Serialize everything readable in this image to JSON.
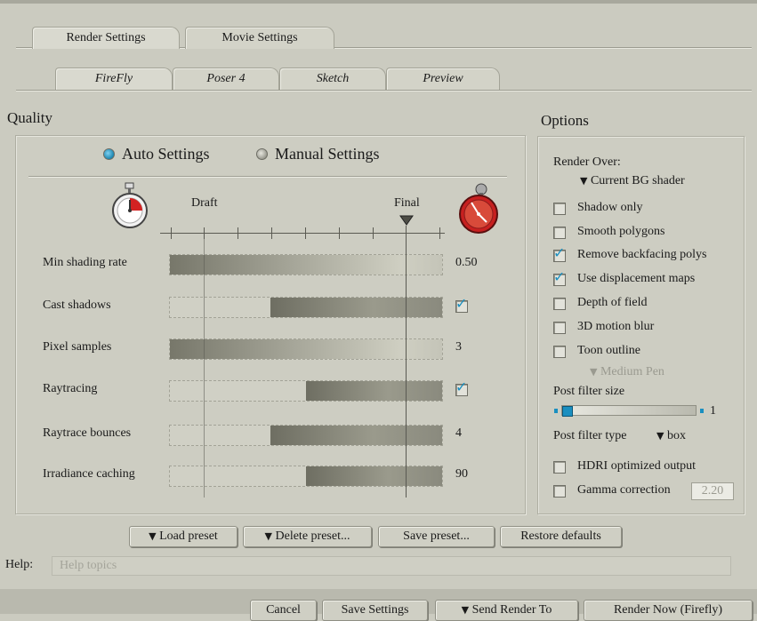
{
  "tabs_top": [
    "Render Settings",
    "Movie Settings"
  ],
  "tabs_sub": [
    "FireFly",
    "Poser 4",
    "Sketch",
    "Preview"
  ],
  "quality": {
    "title": "Quality",
    "auto_label": "Auto Settings",
    "manual_label": "Manual Settings",
    "draft_label": "Draft",
    "final_label": "Final",
    "rows": [
      {
        "label": "Min shading rate",
        "value": "0.50",
        "level": 1.0
      },
      {
        "label": "Cast shadows",
        "value": "",
        "level": 0.63
      },
      {
        "label": "Pixel samples",
        "value": "3",
        "level": 1.0
      },
      {
        "label": "Raytracing",
        "value": "",
        "level": 0.5
      },
      {
        "label": "Raytrace bounces",
        "value": "4",
        "level": 0.63
      },
      {
        "label": "Irradiance caching",
        "value": "90",
        "level": 0.5
      }
    ]
  },
  "options": {
    "title": "Options",
    "render_over_label": "Render Over:",
    "render_over_value": "Current BG shader",
    "shadow_only": "Shadow only",
    "smooth_polygons": "Smooth polygons",
    "remove_backfacing": "Remove backfacing polys",
    "use_displacement": "Use displacement maps",
    "depth_of_field": "Depth of field",
    "motion_blur": "3D motion blur",
    "toon_outline": "Toon outline",
    "toon_pen": "Medium Pen",
    "post_filter_size_label": "Post filter size",
    "post_filter_size_value": "1",
    "post_filter_type_label": "Post filter type",
    "post_filter_type_value": "box",
    "hdri": "HDRI optimized output",
    "gamma": "Gamma correction",
    "gamma_value": "2.20"
  },
  "presets": {
    "load": "Load preset",
    "delete": "Delete preset...",
    "save": "Save preset...",
    "restore": "Restore defaults"
  },
  "help": {
    "label": "Help:",
    "placeholder": "Help topics"
  },
  "footer": {
    "cancel": "Cancel",
    "save_settings": "Save Settings",
    "send_render_to": "Send Render To",
    "render_now": "Render Now (Firefly)"
  }
}
